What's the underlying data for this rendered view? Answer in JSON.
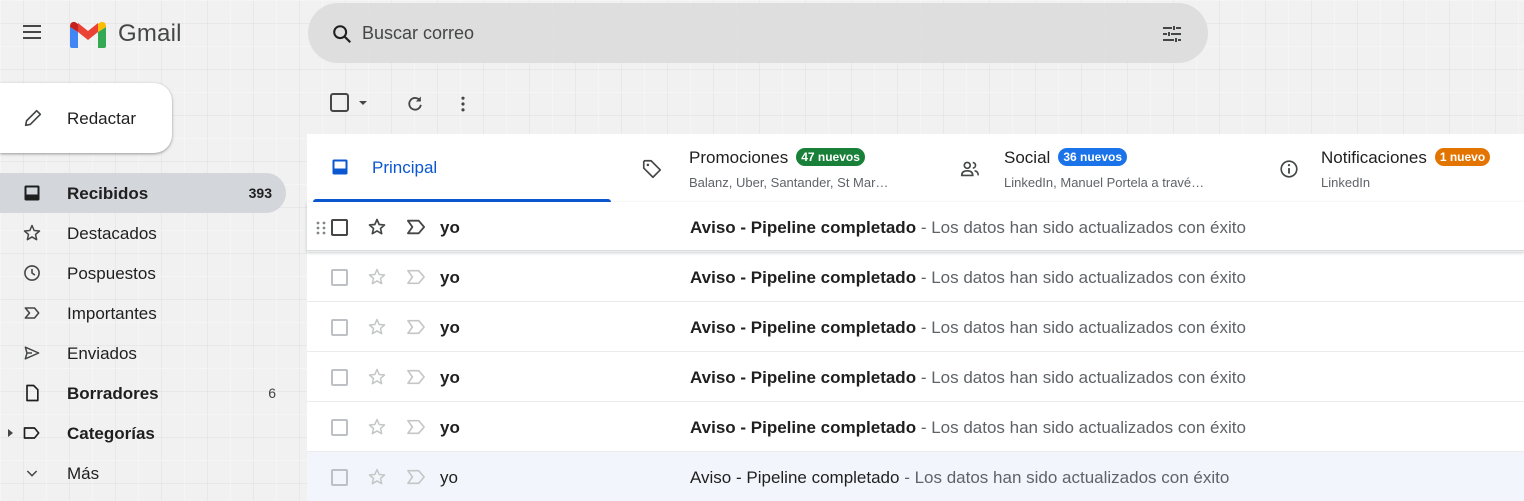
{
  "app": {
    "name": "Gmail"
  },
  "header": {
    "search_placeholder": "Buscar correo",
    "search_value": ""
  },
  "sidebar": {
    "compose_label": "Redactar",
    "items": [
      {
        "label": "Recibidos",
        "count": "393",
        "icon": "inbox-icon",
        "active": true,
        "bold": true
      },
      {
        "label": "Destacados",
        "count": "",
        "icon": "star-icon",
        "active": false,
        "bold": false
      },
      {
        "label": "Pospuestos",
        "count": "",
        "icon": "clock-icon",
        "active": false,
        "bold": false
      },
      {
        "label": "Importantes",
        "count": "",
        "icon": "important-icon",
        "active": false,
        "bold": false
      },
      {
        "label": "Enviados",
        "count": "",
        "icon": "send-icon",
        "active": false,
        "bold": false
      },
      {
        "label": "Borradores",
        "count": "6",
        "icon": "draft-icon",
        "active": false,
        "bold": true
      },
      {
        "label": "Categorías",
        "count": "",
        "icon": "label-icon",
        "active": false,
        "bold": true
      },
      {
        "label": "Más",
        "count": "",
        "icon": "chevron-down-icon",
        "active": false,
        "bold": false
      }
    ]
  },
  "tabs": [
    {
      "title": "Principal",
      "badge": "",
      "subtitle": "",
      "active": true,
      "icon": "inbox-icon"
    },
    {
      "title": "Promociones",
      "badge": "47 nuevos",
      "badge_color": "#188038",
      "subtitle": "Balanz, Uber, Santander, St Mar…",
      "active": false,
      "icon": "tag-icon"
    },
    {
      "title": "Social",
      "badge": "36 nuevos",
      "badge_color": "#1a73e8",
      "subtitle": "LinkedIn, Manuel Portela a travé…",
      "active": false,
      "icon": "people-icon"
    },
    {
      "title": "Notificaciones",
      "badge": "1 nuevo",
      "badge_color": "#e37400",
      "subtitle": "LinkedIn",
      "active": false,
      "icon": "info-icon"
    }
  ],
  "emails": [
    {
      "sender": "yo",
      "subject": "Aviso - Pipeline completado",
      "snippet": " - Los datos han sido actualizados con éxito",
      "unread": true
    },
    {
      "sender": "yo",
      "subject": "Aviso - Pipeline completado",
      "snippet": " - Los datos han sido actualizados con éxito",
      "unread": true
    },
    {
      "sender": "yo",
      "subject": "Aviso - Pipeline completado",
      "snippet": " - Los datos han sido actualizados con éxito",
      "unread": true
    },
    {
      "sender": "yo",
      "subject": "Aviso - Pipeline completado",
      "snippet": " - Los datos han sido actualizados con éxito",
      "unread": true
    },
    {
      "sender": "yo",
      "subject": "Aviso - Pipeline completado",
      "snippet": " - Los datos han sido actualizados con éxito",
      "unread": true
    },
    {
      "sender": "yo",
      "subject": "Aviso - Pipeline completado",
      "snippet": " - Los datos han sido actualizados con éxito",
      "unread": false
    }
  ],
  "colors": {
    "accent": "#0b57d0",
    "active_nav_bg": "#d3d6db",
    "gmail_red": "#ea4335",
    "gmail_blue": "#4285f4",
    "gmail_green": "#34a853",
    "gmail_yellow": "#fbbc04"
  }
}
